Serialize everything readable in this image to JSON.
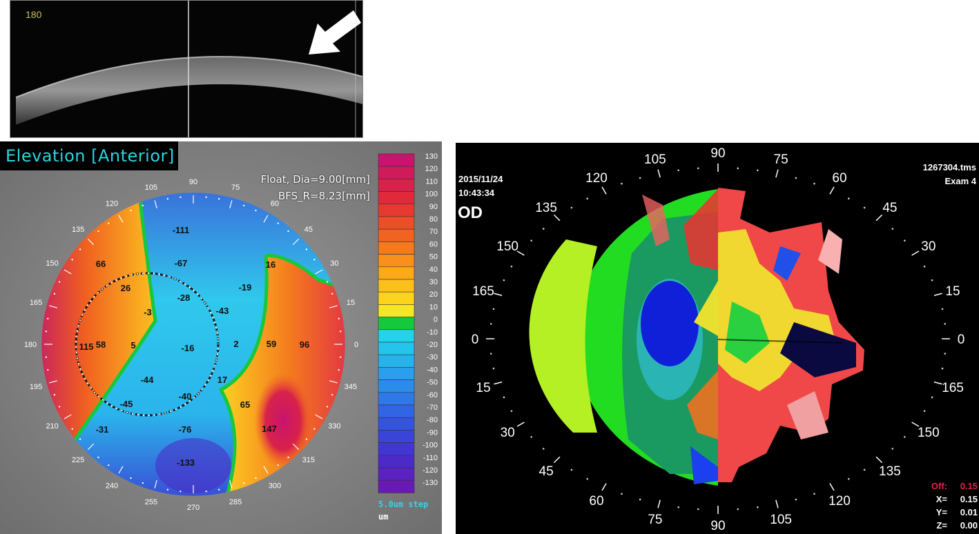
{
  "oct_scan": {
    "meridian_label": "180",
    "arrow": "white-arrow-icon"
  },
  "elevation_map": {
    "title": "Elevation [Anterior]",
    "float_line": "Float, Dia=9.00[mm]",
    "bfs_line": "BFS_R=8.23[mm]",
    "angle_labels": [
      "105",
      "90",
      "75",
      "60",
      "45",
      "30",
      "15",
      "0",
      "345",
      "330",
      "315",
      "300",
      "285",
      "270",
      "255",
      "240",
      "225",
      "210",
      "195",
      "180",
      "165",
      "150",
      "135",
      "120"
    ],
    "values": [
      "-111",
      "-67",
      "66",
      "16",
      "26",
      "-28",
      "-19",
      "-3",
      "-43",
      "115",
      "58",
      "5",
      "-16",
      "2",
      "59",
      "96",
      "-44",
      "17",
      "-40",
      "-45",
      "65",
      "-31",
      "-76",
      "147",
      "-133"
    ],
    "scale_labels": [
      "130",
      "120",
      "110",
      "100",
      "90",
      "80",
      "70",
      "60",
      "50",
      "40",
      "30",
      "20",
      "10",
      "0",
      "-10",
      "-20",
      "-30",
      "-40",
      "-50",
      "-60",
      "-70",
      "-80",
      "-90",
      "-100",
      "-110",
      "-120",
      "-130"
    ],
    "scale_colors": [
      "#c8146e",
      "#d01a5a",
      "#d8224a",
      "#e02a3c",
      "#e63a30",
      "#ec4e28",
      "#f06422",
      "#f47a1e",
      "#f8901c",
      "#fba81a",
      "#fcc01c",
      "#fcd41e",
      "#f6e626",
      "#16c83c",
      "#22d4ea",
      "#24c4ec",
      "#28b2ec",
      "#2aa0ec",
      "#2c8cea",
      "#2e78e8",
      "#3066e4",
      "#3454de",
      "#3a44d8",
      "#4236d2",
      "#4c2ac8",
      "#5a22be",
      "#6a1ab4"
    ],
    "step_label": "5.0um step",
    "unit_label": "um"
  },
  "topography_map": {
    "date": "2015/11/24",
    "time": "10:43:34",
    "eye": "OD",
    "file": "1267304.tms",
    "exam": "Exam 4",
    "angle_labels": [
      "105",
      "90",
      "75",
      "60",
      "45",
      "30",
      "15",
      "0",
      "165",
      "150",
      "135",
      "120",
      "105",
      "90",
      "75",
      "60",
      "45",
      "30",
      "15",
      "0",
      "165",
      "150",
      "135",
      "120"
    ],
    "readouts": [
      {
        "label": "Off:",
        "value": "0.15",
        "color": "#e8204a"
      },
      {
        "label": "X=",
        "value": "0.15",
        "color": "#ffffff"
      },
      {
        "label": "Y=",
        "value": "0.01",
        "color": "#ffffff"
      },
      {
        "label": "Z=",
        "value": "0.00",
        "color": "#ffffff"
      }
    ]
  }
}
